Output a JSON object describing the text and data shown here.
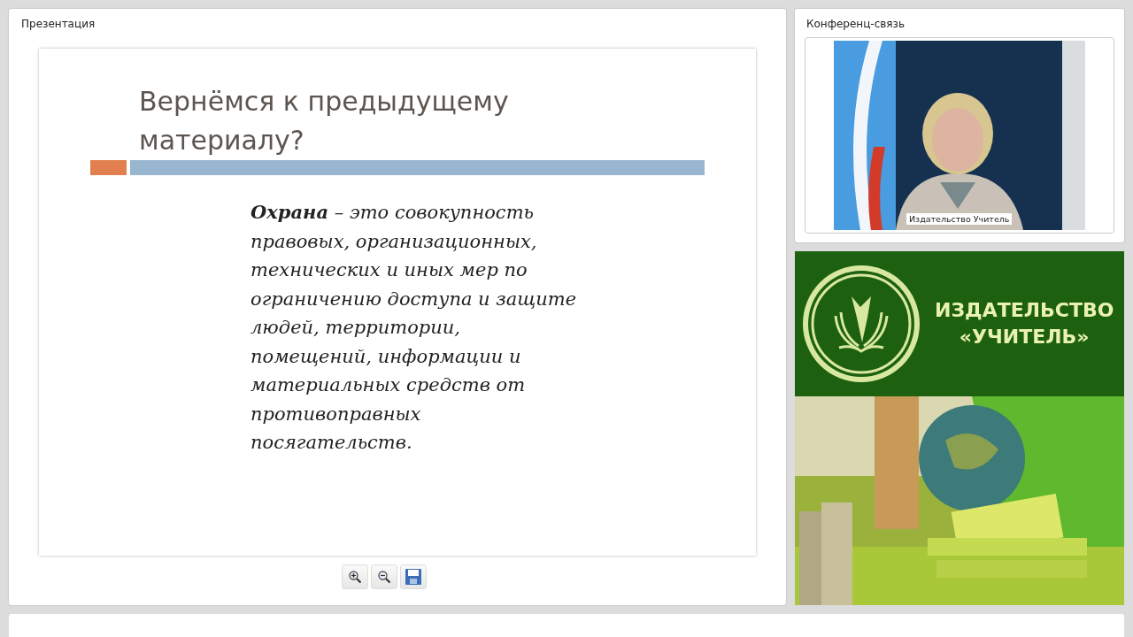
{
  "presentation": {
    "title": "Презентация",
    "slide": {
      "heading": "Вернёмся к предыдущему материалу?",
      "body": "**Охрана** – это *совокупность правовых, организационных, технических и иных мер по ограничению доступа и защите людей, территории, помещений, информации и материальных средств от противоправных посягательств*."
    },
    "toolbar": [
      {
        "kind": "zoom-in"
      },
      {
        "kind": "zoom-out"
      },
      {
        "kind": "save"
      }
    ]
  },
  "conference": {
    "title": "Конференц-связь",
    "video": {
      "kind": "picture",
      "caption": "Издательство Учитель"
    }
  },
  "banner": {
    "lines": [
      "ИЗДАТЕЛЬСТВО",
      "«УЧИТЕЛЬ»"
    ],
    "photo": {
      "kind": "picture"
    }
  }
}
